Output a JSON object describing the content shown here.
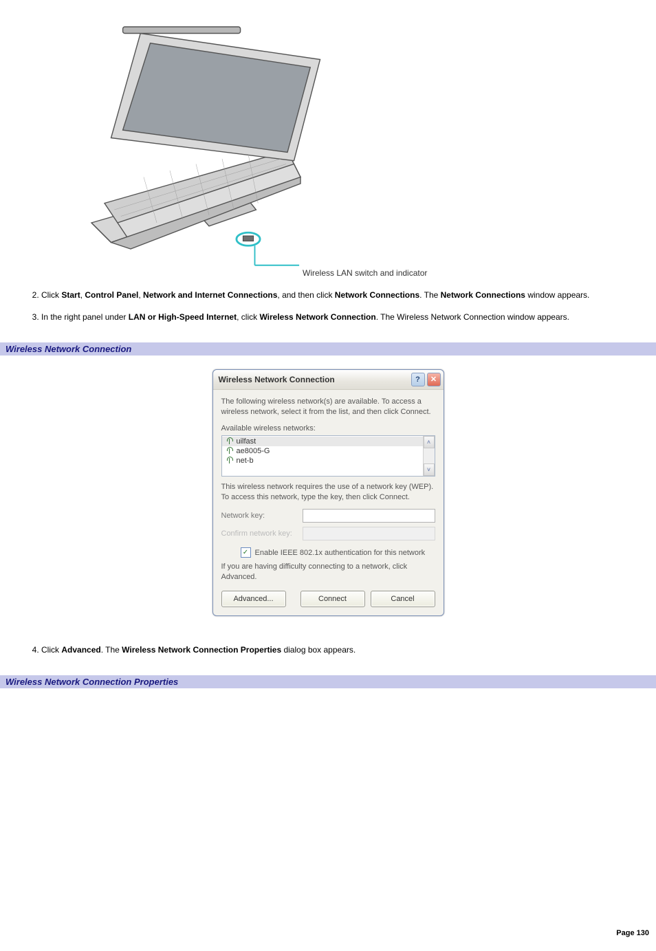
{
  "figure": {
    "label": "Wireless LAN switch and indicator"
  },
  "steps": {
    "s2": {
      "prefix": "Click ",
      "b1": "Start",
      "c1": ", ",
      "b2": "Control Panel",
      "c2": ", ",
      "b3": "Network and Internet Connections",
      "c3": ", and then click ",
      "b4": "Network Connections",
      "c4": ". The ",
      "b5": "Network Connections",
      "suffix": " window appears."
    },
    "s3": {
      "prefix": "In the right panel under ",
      "b1": "LAN or High-Speed Internet",
      "mid": ", click ",
      "b2": "Wireless Network Connection",
      "suffix": ". The Wireless Network Connection window appears."
    },
    "s4": {
      "prefix": "Click ",
      "b1": "Advanced",
      "mid": ". The ",
      "b2": "Wireless Network Connection Properties",
      "suffix": " dialog box appears."
    }
  },
  "sections": {
    "wnc": "Wireless Network Connection",
    "wncp": "Wireless Network Connection Properties"
  },
  "dialog": {
    "title": "Wireless Network Connection",
    "help": "?",
    "close": "✕",
    "intro": "The following wireless network(s) are available. To access a wireless network, select it from the list, and then click Connect.",
    "available_label": "Available wireless networks:",
    "networks": [
      "uilfast",
      "ae8005-G",
      "net-b"
    ],
    "scroll_up": "˄",
    "scroll_down": "˅",
    "wep_text": "This wireless network requires the use of a network key (WEP). To access this network, type the key, then click Connect.",
    "nk_label": "Network key:",
    "cnk_label": "Confirm network key:",
    "chk_mark": "✓",
    "chk_label": "Enable IEEE 802.1x authentication for this network",
    "hint": "If you are having difficulty connecting to a network, click Advanced.",
    "advanced_btn": "Advanced...",
    "connect_btn": "Connect",
    "cancel_btn": "Cancel"
  },
  "footer": {
    "text": "Page 130"
  }
}
